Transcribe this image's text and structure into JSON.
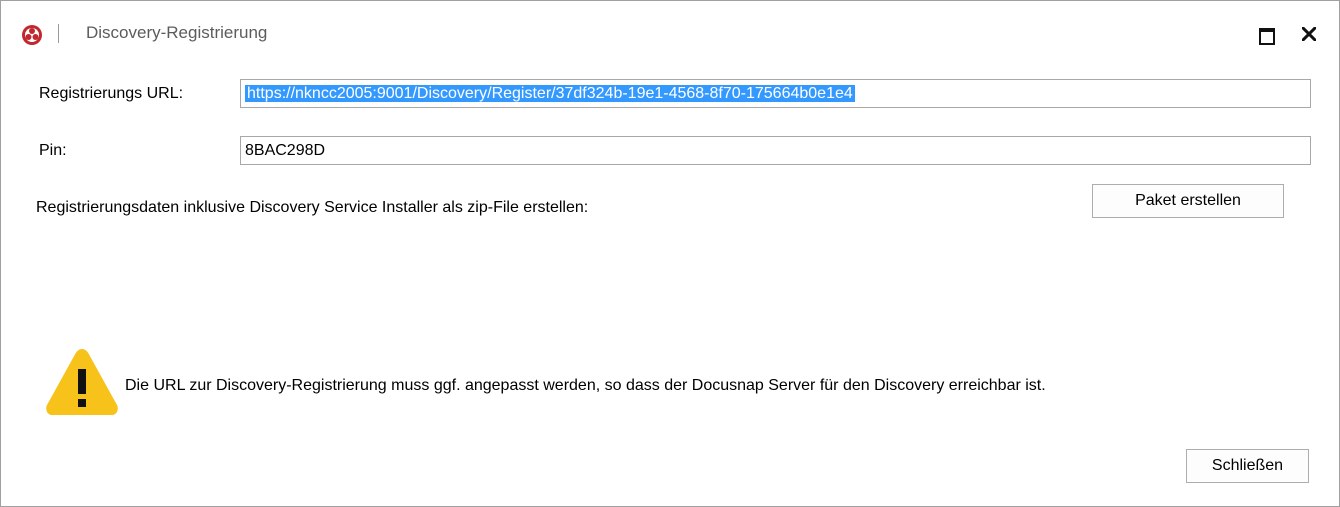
{
  "window": {
    "title": "Discovery-Registrierung"
  },
  "form": {
    "url_label": "Registrierungs URL:",
    "url_value": "https://nkncc2005:9001/Discovery/Register/37df324b-19e1-4568-8f70-175664b0e1e4",
    "pin_label": "Pin:",
    "pin_value": "8BAC298D",
    "package_text": "Registrierungsdaten inklusive Discovery Service Installer als zip-File erstellen:",
    "package_button": "Paket erstellen"
  },
  "notice": {
    "text": "Die URL zur Discovery-Registrierung muss ggf. angepasst werden, so dass der Docusnap Server für den Discovery erreichbar ist."
  },
  "footer": {
    "close_button": "Schließen"
  },
  "colors": {
    "selection": "#3399ff",
    "warning": "#f7c21a",
    "app_icon": "#c0282e"
  }
}
